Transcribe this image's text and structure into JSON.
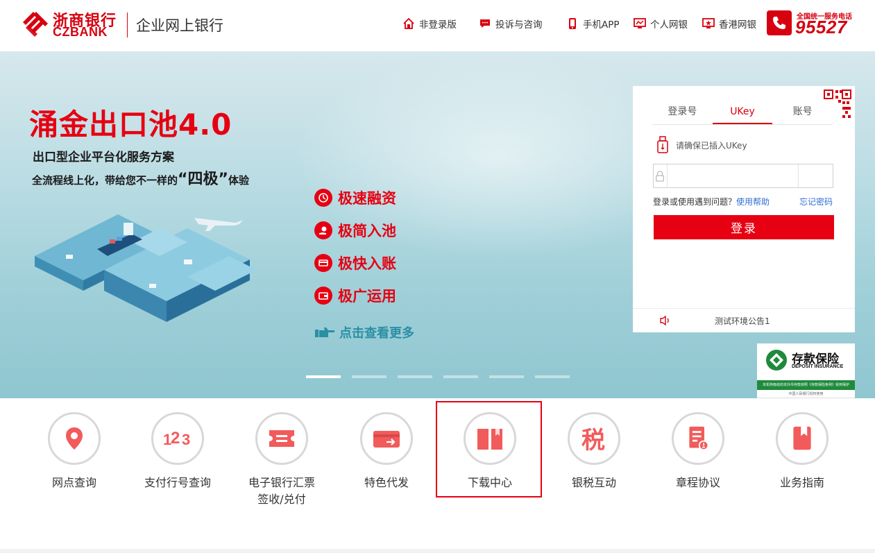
{
  "header": {
    "logo_cn": "浙商银行",
    "logo_en": "CZBANK",
    "subtitle": "企业网上银行",
    "nav": [
      {
        "label": "非登录版",
        "icon": "home-icon"
      },
      {
        "label": "投诉与咨询",
        "icon": "chat-icon"
      },
      {
        "label": "手机APP",
        "icon": "mobile-icon"
      },
      {
        "label": "个人网银",
        "icon": "monitor-icon"
      },
      {
        "label": "香港网银",
        "icon": "hk-monitor-icon"
      }
    ],
    "hotline_label": "全国统一服务电话",
    "hotline_number": "95527"
  },
  "banner": {
    "title": "涌金出口池4.0",
    "subtitle1": "出口型企业平台化服务方案",
    "subtitle2_pre": "全流程线上化，带给您不一样的",
    "subtitle2_big": "“四极”",
    "subtitle2_post": "体验",
    "features": [
      "极速融资",
      "极简入池",
      "极快入账",
      "极广运用"
    ],
    "more": "点击查看更多",
    "slide_count": 6,
    "active_slide": 1
  },
  "login": {
    "tabs": [
      {
        "label": "登录号",
        "active": false
      },
      {
        "label": "UKey",
        "active": true
      },
      {
        "label": "账号",
        "active": false
      }
    ],
    "ukey_tip": "请确保已插入UKey",
    "password_value": "",
    "help_text": "登录或使用遇到问题？",
    "help_link": "使用帮助",
    "forgot": "忘记密码",
    "button": "登录",
    "notice": "测试环境公告1"
  },
  "deposit": {
    "cn": "存款保险",
    "en": "DEPOSIT INSURANCE",
    "bar": "本机构吸收的本外币存款依照《存款保险条例》受到保护",
    "foot": "中国人民银行授权使用"
  },
  "services": [
    {
      "label": "网点查询",
      "icon": "location-pin-icon"
    },
    {
      "label": "支付行号查询",
      "icon": "number-123-icon"
    },
    {
      "label": "电子银行汇票签收/兑付",
      "label_line1": "电子银行汇票",
      "label_line2": "签收/兑付",
      "icon": "ticket-icon"
    },
    {
      "label": "特色代发",
      "icon": "card-transfer-icon"
    },
    {
      "label": "下载中心",
      "icon": "book-download-icon",
      "highlighted": true
    },
    {
      "label": "银税互动",
      "icon": "tax-icon"
    },
    {
      "label": "章程协议",
      "icon": "document-seal-icon"
    },
    {
      "label": "业务指南",
      "icon": "bookmark-guide-icon"
    }
  ],
  "colors": {
    "brand_red": "#d7000f",
    "link_blue": "#2f6fd0",
    "more_teal": "#2a8fa4",
    "deposit_green": "#1f8a3c"
  }
}
